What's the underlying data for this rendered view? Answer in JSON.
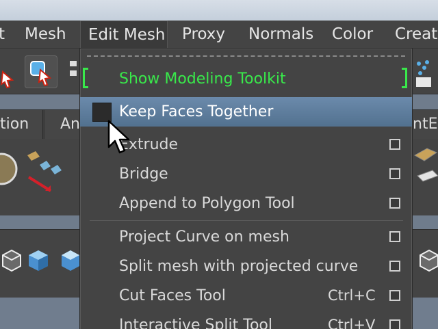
{
  "menubar": {
    "items": [
      {
        "label": "t"
      },
      {
        "label": "Mesh"
      },
      {
        "label": "Edit Mesh"
      },
      {
        "label": "Proxy"
      },
      {
        "label": "Normals"
      },
      {
        "label": "Color"
      },
      {
        "label": "Creat"
      }
    ]
  },
  "tabs": [
    {
      "label": "tion"
    },
    {
      "label": "An"
    },
    {
      "label": "ntE"
    }
  ],
  "dropdown": {
    "toolkit": {
      "label": "Show Modeling Toolkit"
    },
    "items": [
      {
        "label": "Keep Faces Together",
        "shortcut": ""
      },
      {
        "label": "Extrude",
        "shortcut": ""
      },
      {
        "label": "Bridge",
        "shortcut": ""
      },
      {
        "label": "Append to Polygon Tool",
        "shortcut": ""
      },
      {
        "label": "Project Curve on mesh",
        "shortcut": ""
      },
      {
        "label": "Split mesh with projected curve",
        "shortcut": ""
      },
      {
        "label": "Cut Faces Tool",
        "shortcut": "Ctrl+C"
      },
      {
        "label": "Interactive Split Tool",
        "shortcut": "Ctrl+V"
      }
    ]
  },
  "colors": {
    "accent_green": "#39e84b",
    "highlight_blue": "#5f7fa0",
    "menu_bg": "#444444"
  }
}
